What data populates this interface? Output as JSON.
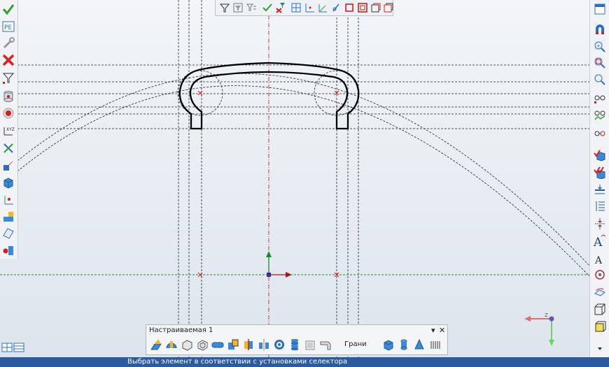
{
  "toolbar_panel": {
    "title": "Настраиваемая 1",
    "dropdown_glyph": "▾",
    "close_glyph": "✕",
    "faces_label": "Грани"
  },
  "status_bar": {
    "text": "Выбрать элемент в соответствии с установками селектора"
  },
  "colors": {
    "status_bg": "#2c5aa0",
    "check_green": "#2aa52a",
    "delete_red": "#e0201c",
    "axis_red": "#c0182c",
    "axis_green": "#2b8a3e"
  },
  "left_toolbar_icons": [
    "accept-check-icon",
    "parameters-pe-icon",
    "wrench-icon",
    "cancel-x-icon",
    "filter-cursor-icon",
    "database-cylinder-icon",
    "record-stop-icon",
    "coordinate-xyz-icon",
    "axis-cross-icon",
    "add-points-icon",
    "cube-icon",
    "point-axes-icon",
    "multi-cube-icon",
    "plane-icon",
    "insert-part-icon"
  ],
  "right_toolbar_icons": [
    "window-icon",
    "magnet-icon",
    "zoom-in-icon",
    "zoom-fit-icon",
    "zoom-window-icon",
    "glasses-icon",
    "glasses-edit-icon",
    "glasses-red-icon",
    "cube-check-icon",
    "cube-multi-check-icon",
    "dimension-icon",
    "vertical-dimension-icon",
    "compress-icon",
    "text-a-icon",
    "text-a-small-icon",
    "rotate-target-icon",
    "rotate-plane-icon",
    "view-cube-icon",
    "cube-yellow-icon",
    "scroll-down-icon"
  ],
  "selector_icons": [
    "filter-icon",
    "filter-all-icon",
    "filter-tree-icon",
    "check-filter-icon",
    "pick-point-icon",
    "point-icon",
    "point-axes-icon",
    "line-icon",
    "box-icon",
    "box-red-icon",
    "box-red-2-icon",
    "box-outline-icon"
  ],
  "bottom_toolbar_icons": [
    "extrude-icon",
    "revolve-icon",
    "solid-icon",
    "shell-icon",
    "cylinder-icon",
    "combine-icon",
    "split-icon",
    "mirror-icon",
    "spiral-icon",
    "stack-icon",
    "box-transparent-icon",
    "bend-icon",
    "cube-blue-icon",
    "cylinder-blue-icon",
    "cone-blue-icon",
    "thread-icon"
  ]
}
